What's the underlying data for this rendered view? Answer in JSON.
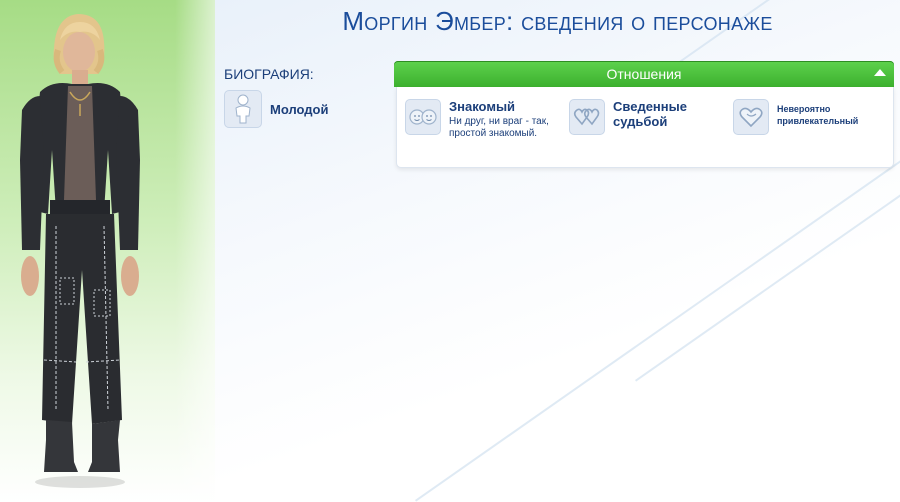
{
  "title": "Моргин Эмбер: сведения о персонаже",
  "biography": {
    "label": "БИОГРАФИЯ:",
    "age": "Молодой"
  },
  "relationships": {
    "header": "Отношения",
    "items": [
      {
        "name": "Знакомый",
        "description": "Ни друг, ни враг - так, простой знакомый.",
        "icon": "faces-icon"
      },
      {
        "name": "Сведенные судьбой",
        "description": "",
        "icon": "linked-hearts-icon"
      },
      {
        "name": "Невероятно привлекательный",
        "description": "",
        "icon": "heart-outline-icon"
      }
    ]
  },
  "colors": {
    "title": "#1b4d9b",
    "header_green": "#3cb02e",
    "panel_green": "#a6dc85"
  }
}
